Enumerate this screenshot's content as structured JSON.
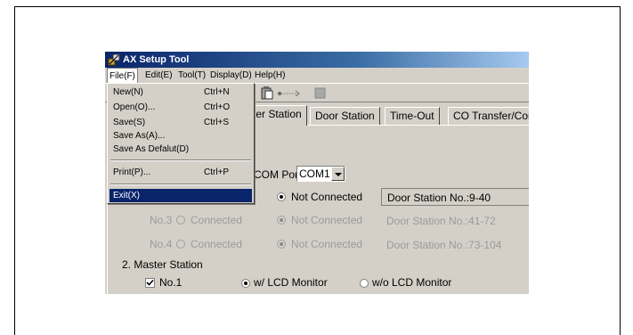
{
  "window": {
    "title": "AX Setup Tool"
  },
  "menubar": {
    "items": [
      {
        "label": "File(F)"
      },
      {
        "label": "Edit(E)"
      },
      {
        "label": "Tool(T)"
      },
      {
        "label": "Display(D)"
      },
      {
        "label": "Help(H)"
      }
    ]
  },
  "file_menu": {
    "items": [
      {
        "label": "New(N)",
        "shortcut": "Ctrl+N"
      },
      {
        "label": "Open(O)...",
        "shortcut": "Ctrl+O"
      },
      {
        "label": "Save(S)",
        "shortcut": "Ctrl+S"
      },
      {
        "label": "Save As(A)...",
        "shortcut": ""
      },
      {
        "label": "Save As Defalut(D)",
        "shortcut": ""
      },
      {
        "label": "Print(P)...",
        "shortcut": "Ctrl+P"
      },
      {
        "label": "Exit(X)",
        "shortcut": ""
      }
    ]
  },
  "tabs": [
    {
      "label": "ter Station"
    },
    {
      "label": "Door Station"
    },
    {
      "label": "Time-Out"
    },
    {
      "label": "CO Transfer/Comm"
    }
  ],
  "com_port": {
    "label": "COM Port",
    "value": "COM1"
  },
  "door_rows": [
    {
      "no": "",
      "connected": "",
      "not_connected": "Not Connected",
      "range": "Door Station No.:9-40",
      "enabled": true
    },
    {
      "no": "No.3",
      "connected": "Connected",
      "not_connected": "Not Connected",
      "range": "Door Station No.:41-72",
      "enabled": false
    },
    {
      "no": "No.4",
      "connected": "Connected",
      "not_connected": "Not Connected",
      "range": "Door Station No.:73-104",
      "enabled": false
    }
  ],
  "master_station": {
    "heading": "2. Master Station",
    "no1_label": "No.1",
    "no1_checked": true,
    "lcd_label": "w/ LCD Monitor",
    "no_lcd_label": "w/o LCD Monitor",
    "lcd_selected": true
  },
  "colors": {
    "titlebar": "#0a246a",
    "highlight": "#0a246a",
    "face": "#d4d0c8"
  },
  "icons": [
    "app-icon",
    "paste-icon",
    "cable-icon",
    "disconnect-icon"
  ]
}
